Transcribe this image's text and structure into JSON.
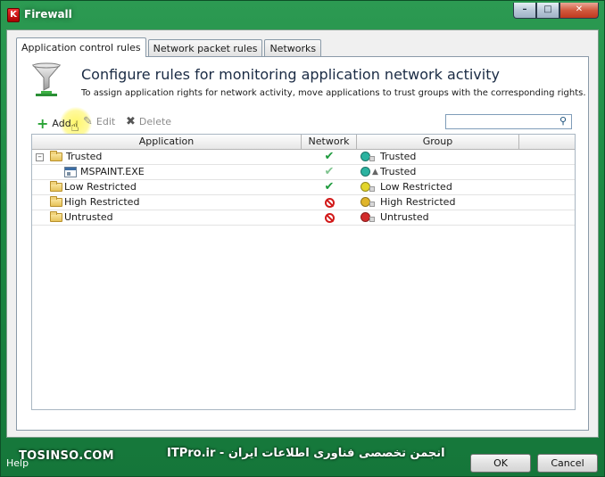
{
  "window": {
    "title": "Firewall",
    "icon_letter": "K",
    "caption_buttons": [
      "minimize-icon",
      "maximize-icon",
      "close-icon"
    ]
  },
  "tabs": [
    {
      "label": "Application control rules",
      "active": true
    },
    {
      "label": "Network packet rules",
      "active": false
    },
    {
      "label": "Networks",
      "active": false
    }
  ],
  "header": {
    "title": "Configure rules for monitoring application network activity",
    "subtitle": "To assign application rights for network activity, move applications to trust groups with the corresponding rights.",
    "icon": "funnel-icon"
  },
  "toolbar": {
    "add_label": "Add",
    "edit_label": "Edit",
    "delete_label": "Delete",
    "search_value": ""
  },
  "table": {
    "columns": [
      "Application",
      "Network",
      "Group",
      ""
    ],
    "rows": [
      {
        "name": "Trusted",
        "indent": 0,
        "expandable": true,
        "icon": "folder-icon",
        "network": "allow",
        "group": "Trusted",
        "group_color": "#2bb3a0"
      },
      {
        "name": "MSPAINT.EXE",
        "indent": 1,
        "expandable": false,
        "icon": "exe-icon",
        "network": "allow-inherited",
        "group": "Trusted",
        "group_color": "#2bb3a0"
      },
      {
        "name": "Low Restricted",
        "indent": 0,
        "expandable": false,
        "icon": "folder-icon",
        "network": "allow",
        "group": "Low Restricted",
        "group_color": "#e2d52a"
      },
      {
        "name": "High Restricted",
        "indent": 0,
        "expandable": false,
        "icon": "folder-icon",
        "network": "block",
        "group": "High Restricted",
        "group_color": "#e0b52a"
      },
      {
        "name": "Untrusted",
        "indent": 0,
        "expandable": false,
        "icon": "folder-icon",
        "network": "block",
        "group": "Untrusted",
        "group_color": "#d22b2b"
      }
    ]
  },
  "footer": {
    "help_label": "Help",
    "ok_label": "OK",
    "cancel_label": "Cancel"
  },
  "watermark": {
    "left": "TOSINSO.COM",
    "right": "ITPro.ir - انجمن تخصصی فناوری اطلاعات ایران"
  },
  "colors": {
    "frame_green": "#1d8a43",
    "allow_green": "#1d9a3c",
    "block_red": "#d21a1a"
  }
}
